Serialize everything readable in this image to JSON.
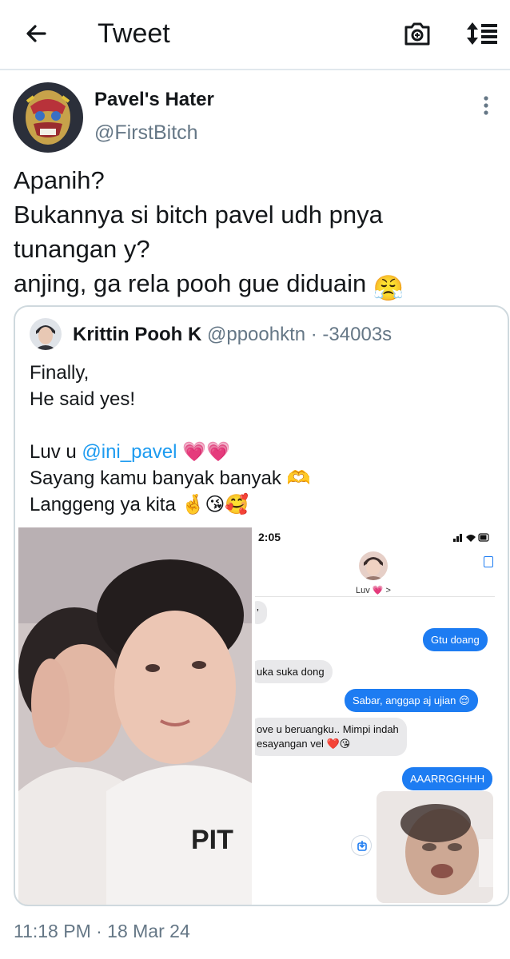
{
  "header": {
    "title": "Tweet",
    "back_icon": "arrow-left-icon",
    "camera_icon": "camera-icon",
    "sort_icon": "sort-icon"
  },
  "tweet": {
    "author_name": "Pavel's Hater",
    "author_handle": "@FirstBitch",
    "text_lines": [
      "Apanih?",
      "Bukannya si bitch pavel udh pnya",
      "tunangan y?",
      "anjing, ga rela pooh gue diduain"
    ],
    "text_emoji": "😤",
    "timestamp": "11:18 PM · 18 Mar 24"
  },
  "quoted_tweet": {
    "author_name": "Krittin Pooh K",
    "author_handle": "@ppoohktn · -34003s",
    "line1": "Finally,",
    "line2": "He said yes!",
    "line3_prefix": "Luv u ",
    "mention": "@ini_pavel",
    "line3_emoji": "💗💗",
    "line4": "Sayang kamu banyak banyak",
    "line4_emoji": "🫶",
    "line5": "Langgeng ya kita",
    "line5_emoji": "🤞😘🥰"
  },
  "chat": {
    "time": "2:05",
    "contact": "Luv 💗 >",
    "msg_in_1": "’",
    "msg_out_1": "Gtu doang",
    "msg_in_2": "uka suka dong",
    "msg_out_2": "Sabar, anggap aj ujian 😌",
    "msg_in_3a": "ove u beruangku.. Mimpi indah",
    "msg_in_3b": "esayangan vel ❤️😘",
    "msg_out_3": "AAARRGGHHH"
  },
  "colors": {
    "accent": "#1d9bf0",
    "secondary_text": "#657786",
    "border": "#cfd9de",
    "imessage_blue": "#1d7cf2"
  }
}
